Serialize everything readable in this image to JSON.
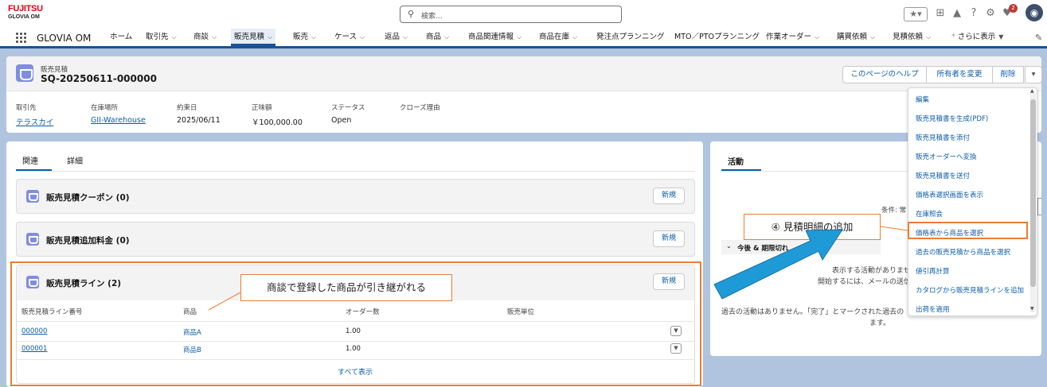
{
  "header": {
    "logo_line1": "FUJITSU",
    "logo_line2": "GLOVIA OM",
    "search_placeholder": "検索...",
    "notification_count": "2"
  },
  "nav": {
    "app_name": "GLOVIA OM",
    "items": [
      {
        "label": "ホーム",
        "chevron": false
      },
      {
        "label": "取引先",
        "chevron": true
      },
      {
        "label": "商談",
        "chevron": true
      },
      {
        "label": "販売見積",
        "chevron": true,
        "active": true
      },
      {
        "label": "販売",
        "chevron": true
      },
      {
        "label": "ケース",
        "chevron": true
      },
      {
        "label": "返品",
        "chevron": true
      },
      {
        "label": "商品",
        "chevron": true
      },
      {
        "label": "商品関連情報",
        "chevron": true
      },
      {
        "label": "商品在庫",
        "chevron": true
      },
      {
        "label": "発注点プランニング",
        "chevron": false
      },
      {
        "label": "MTO／PTOプランニング",
        "chevron": false
      },
      {
        "label": "作業オーダー",
        "chevron": true
      },
      {
        "label": "購買依頼",
        "chevron": true
      },
      {
        "label": "見積依頼",
        "chevron": true
      },
      {
        "label": "さらに表示",
        "chevron": true
      }
    ]
  },
  "record": {
    "object_label": "販売見積",
    "title": "SQ-20250611-000000",
    "buttons": [
      "このページのヘルプ",
      "所有者を変更",
      "削除"
    ],
    "fields": [
      {
        "label": "取引先",
        "value": "テラスカイ",
        "link": true
      },
      {
        "label": "在庫場所",
        "value": "GII-Warehouse",
        "link": true
      },
      {
        "label": "約束日",
        "value": "2025/06/11",
        "link": false
      },
      {
        "label": "正味額",
        "value": "￥100,000.00",
        "link": false
      },
      {
        "label": "ステータス",
        "value": "Open",
        "link": false
      },
      {
        "label": "クローズ理由",
        "value": "",
        "link": false
      }
    ]
  },
  "left_tabs": [
    "関連",
    "詳細"
  ],
  "related": {
    "coupon_title": "販売見積クーポン (0)",
    "charge_title": "販売見積追加料金 (0)",
    "lines_title": "販売見積ライン (2)",
    "new_label": "新規",
    "columns": [
      "販売見積ライン番号",
      "商品",
      "オーダー数",
      "販売単位"
    ],
    "rows": [
      {
        "no": "000000",
        "product": "商品A",
        "qty": "1.00",
        "unit": ""
      },
      {
        "no": "000001",
        "product": "商品B",
        "qty": "1.00",
        "unit": ""
      }
    ],
    "view_all": "すべて表示"
  },
  "activity": {
    "tab": "活動",
    "filter_prefix": "条件: 常",
    "upcoming": "今後 & 期限切れ",
    "no_activity": "表示する活動がありませ",
    "hint": "開始するには、メールの送信や ToDo のスケ",
    "past": "過去の活動はありません。「完了」とマークされた過去の",
    "past2": "ます。"
  },
  "dropdown": [
    "編集",
    "販売見積書を生成(PDF)",
    "販売見積書を添付",
    "販売オーダーへ変換",
    "販売見積書を送付",
    "価格表選択画面を表示",
    "在庫照会",
    "価格表から商品を選択",
    "過去の販売見積から商品を選択",
    "値引再計算",
    "カタログから販売見積ラインを追加",
    "出荷を適用"
  ],
  "annotations": {
    "step4": "④ 見積明細の追加",
    "carried": "商談で登録した商品が引き継がれる"
  },
  "colors": {
    "brand_red": "#e60012",
    "accent_blue": "#0b5cab",
    "nav_bar": "#1b5297",
    "annotation_orange": "#ed7d31",
    "arrow_blue": "#1e9bd7"
  }
}
